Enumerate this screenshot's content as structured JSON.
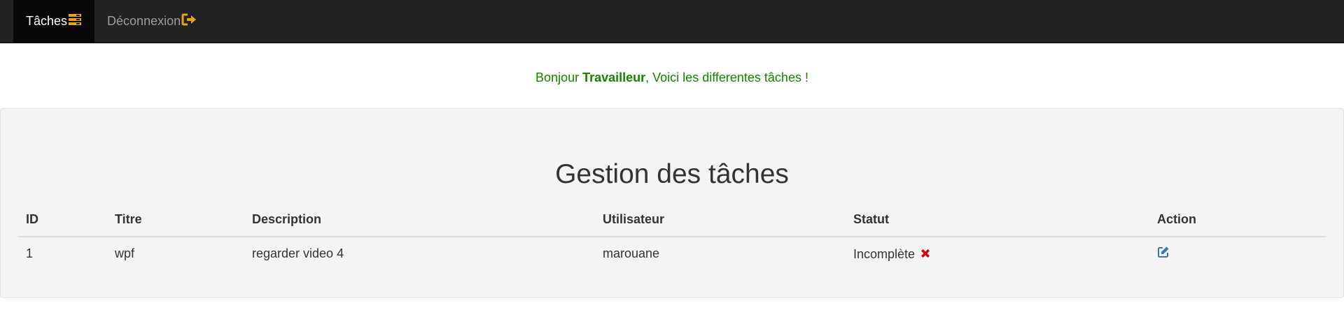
{
  "nav": {
    "tasks_label": "Tâches",
    "tasks_icon": "tasks-icon",
    "logout_label": "Déconnexion",
    "logout_icon": "logout-icon",
    "accent_color": "#e8a317"
  },
  "greeting": {
    "prefix": "Bonjour ",
    "username": "Travailleur",
    "suffix": ", Voici les differentes tâches !"
  },
  "main": {
    "title": "Gestion des tâches",
    "columns": [
      "ID",
      "Titre",
      "Description",
      "Utilisateur",
      "Statut",
      "Action"
    ],
    "rows": [
      {
        "id": "1",
        "titre": "wpf",
        "description": "regarder video 4",
        "utilisateur": "marouane",
        "statut": "Incomplète",
        "status_icon": "cross-icon",
        "action_icon": "edit-icon"
      }
    ]
  }
}
